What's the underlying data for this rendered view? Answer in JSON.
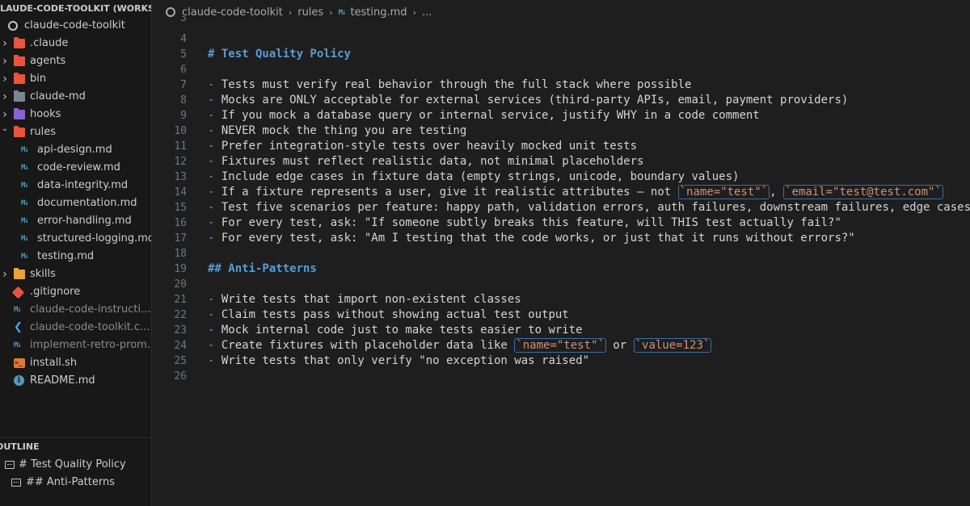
{
  "explorer": {
    "title": "CLAUDE-CODE-TOOLKIT (WORKS...",
    "root": "claude-code-toolkit",
    "items": [
      {
        "label": ".claude",
        "kind": "folder",
        "color": "#e8543d",
        "expanded": false
      },
      {
        "label": "agents",
        "kind": "folder",
        "color": "#e8543d",
        "expanded": false
      },
      {
        "label": "bin",
        "kind": "folder",
        "color": "#e8543d",
        "expanded": false
      },
      {
        "label": "claude-md",
        "kind": "folder",
        "color": "#7d8590",
        "expanded": false
      },
      {
        "label": "hooks",
        "kind": "folder",
        "color": "#8a63d2",
        "expanded": false
      },
      {
        "label": "rules",
        "kind": "folder",
        "color": "#e8543d",
        "expanded": true
      },
      {
        "label": "api-design.md",
        "kind": "md"
      },
      {
        "label": "code-review.md",
        "kind": "md"
      },
      {
        "label": "data-integrity.md",
        "kind": "md"
      },
      {
        "label": "documentation.md",
        "kind": "md"
      },
      {
        "label": "error-handling.md",
        "kind": "md"
      },
      {
        "label": "structured-logging.md",
        "kind": "md"
      },
      {
        "label": "testing.md",
        "kind": "md"
      },
      {
        "label": "skills",
        "kind": "folder",
        "color": "#e8a33d",
        "expanded": false
      },
      {
        "label": ".gitignore",
        "kind": "git"
      },
      {
        "label": "claude-code-instructi...",
        "kind": "md",
        "dim": true
      },
      {
        "label": "claude-code-toolkit.c...",
        "kind": "vscode",
        "dim": true
      },
      {
        "label": "implement-retro-prom...",
        "kind": "md",
        "dim": true
      },
      {
        "label": "install.sh",
        "kind": "shell"
      },
      {
        "label": "README.md",
        "kind": "info"
      }
    ]
  },
  "outline": {
    "title": "OUTLINE",
    "items": [
      "# Test Quality Policy",
      "## Anti-Patterns"
    ]
  },
  "breadcrumb": {
    "parts": [
      "claude-code-toolkit",
      "rules",
      "testing.md",
      "..."
    ]
  },
  "editor": {
    "cutoff_line_number": "3",
    "lines": [
      {
        "n": "4",
        "segments": []
      },
      {
        "n": "5",
        "segments": [
          {
            "t": "# Test Quality Policy",
            "c": "hd"
          }
        ]
      },
      {
        "n": "6",
        "segments": []
      },
      {
        "n": "7",
        "segments": [
          {
            "t": "- ",
            "c": "dash"
          },
          {
            "t": "Tests must verify real behavior through the full stack where possible"
          }
        ]
      },
      {
        "n": "8",
        "segments": [
          {
            "t": "- ",
            "c": "dash"
          },
          {
            "t": "Mocks are ONLY acceptable for external services (third-party APIs, email, payment providers)"
          }
        ]
      },
      {
        "n": "9",
        "segments": [
          {
            "t": "- ",
            "c": "dash"
          },
          {
            "t": "If you mock a database query or internal service, justify WHY in a code comment"
          }
        ]
      },
      {
        "n": "10",
        "segments": [
          {
            "t": "- ",
            "c": "dash"
          },
          {
            "t": "NEVER mock the thing you are testing"
          }
        ]
      },
      {
        "n": "11",
        "segments": [
          {
            "t": "- ",
            "c": "dash"
          },
          {
            "t": "Prefer integration-style tests over heavily mocked unit tests"
          }
        ]
      },
      {
        "n": "12",
        "segments": [
          {
            "t": "- ",
            "c": "dash"
          },
          {
            "t": "Fixtures must reflect realistic data, not minimal placeholders"
          }
        ]
      },
      {
        "n": "13",
        "segments": [
          {
            "t": "- ",
            "c": "dash"
          },
          {
            "t": "Include edge cases in fixture data (empty strings, unicode, boundary values)"
          }
        ]
      },
      {
        "n": "14",
        "segments": [
          {
            "t": "- ",
            "c": "dash"
          },
          {
            "t": "If a fixture represents a user, give it realistic attributes — not "
          },
          {
            "t": "`name=\"test\"`",
            "c": "ic"
          },
          {
            "t": ", "
          },
          {
            "t": "`email=\"test@test.com\"`",
            "c": "ic"
          }
        ]
      },
      {
        "n": "15",
        "segments": [
          {
            "t": "- ",
            "c": "dash"
          },
          {
            "t": "Test five scenarios per feature: happy path, validation errors, auth failures, downstream failures, edge cases"
          }
        ]
      },
      {
        "n": "16",
        "segments": [
          {
            "t": "- ",
            "c": "dash"
          },
          {
            "t": "For every test, ask: \"If someone subtly breaks this feature, will THIS test actually fail?\""
          }
        ]
      },
      {
        "n": "17",
        "segments": [
          {
            "t": "- ",
            "c": "dash"
          },
          {
            "t": "For every test, ask: \"Am I testing that the code works, or just that it runs without errors?\""
          }
        ]
      },
      {
        "n": "18",
        "segments": []
      },
      {
        "n": "19",
        "segments": [
          {
            "t": "## Anti-Patterns",
            "c": "hd"
          }
        ]
      },
      {
        "n": "20",
        "segments": []
      },
      {
        "n": "21",
        "segments": [
          {
            "t": "- ",
            "c": "dash"
          },
          {
            "t": "Write tests that import non-existent classes"
          }
        ]
      },
      {
        "n": "22",
        "segments": [
          {
            "t": "- ",
            "c": "dash"
          },
          {
            "t": "Claim tests pass without showing actual test output"
          }
        ]
      },
      {
        "n": "23",
        "segments": [
          {
            "t": "- ",
            "c": "dash"
          },
          {
            "t": "Mock internal code just to make tests easier to write"
          }
        ]
      },
      {
        "n": "24",
        "segments": [
          {
            "t": "- ",
            "c": "dash"
          },
          {
            "t": "Create fixtures with placeholder data like "
          },
          {
            "t": "`name=\"test\"`",
            "c": "ic"
          },
          {
            "t": " or "
          },
          {
            "t": "`value=123`",
            "c": "ic"
          }
        ]
      },
      {
        "n": "25",
        "segments": [
          {
            "t": "- ",
            "c": "dash"
          },
          {
            "t": "Write tests that only verify \"no exception was raised\""
          }
        ]
      },
      {
        "n": "26",
        "segments": []
      }
    ]
  }
}
